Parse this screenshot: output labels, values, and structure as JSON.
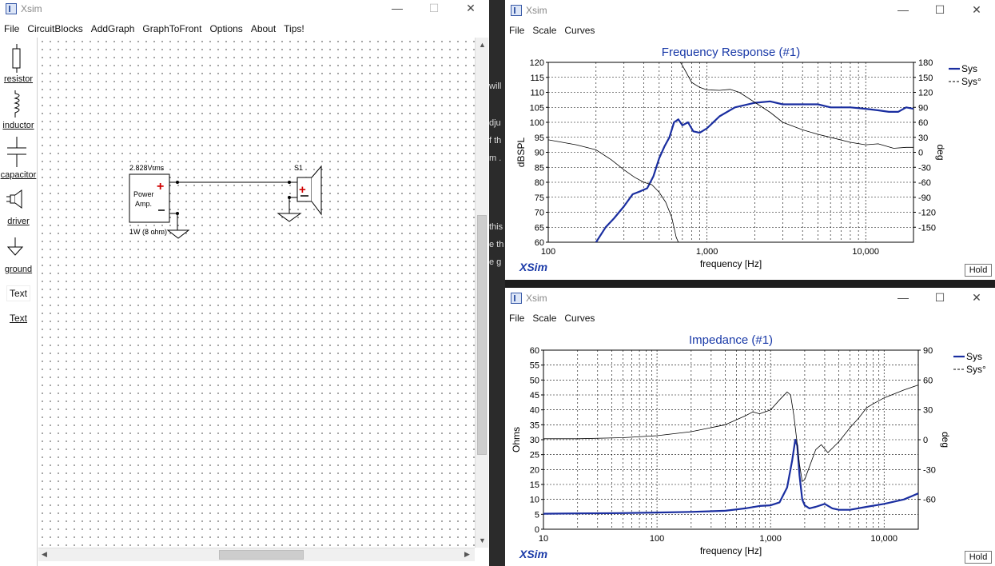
{
  "circuit_window": {
    "title": "Xsim",
    "menu": [
      "File",
      "CircuitBlocks",
      "AddGraph",
      "GraphToFront",
      "Options",
      "About",
      "Tips!"
    ],
    "palette": [
      {
        "label": "resistor",
        "icon": "resistor-icon"
      },
      {
        "label": "inductor",
        "icon": "inductor-icon"
      },
      {
        "label": "capacitor",
        "icon": "capacitor-icon"
      },
      {
        "label": "driver",
        "icon": "driver-icon"
      },
      {
        "label": "ground",
        "icon": "ground-icon"
      },
      {
        "label": "Text",
        "icon": "text-icon",
        "box_text": "Text"
      }
    ],
    "amp": {
      "top_label": "2.828Vrms",
      "body_line1": "Power",
      "body_line2": "Amp.",
      "bottom_label": "1W (8 ohm)"
    },
    "driver_label": "S1"
  },
  "freq_window": {
    "title": "Xsim",
    "menu": [
      "File",
      "Scale",
      "Curves"
    ],
    "hold_label": "Hold",
    "logo": "XSim",
    "chart_data": {
      "type": "line",
      "title": "Frequency Response (#1)",
      "xlabel": "frequency [Hz]",
      "ylabel": "dBSPL",
      "y2label": "deg",
      "xscale": "log",
      "xlim": [
        100,
        20000
      ],
      "ylim": [
        60,
        120
      ],
      "y2lim": [
        -180,
        180
      ],
      "xticks": [
        {
          "v": 100,
          "t": "100"
        },
        {
          "v": 1000,
          "t": "1,000"
        },
        {
          "v": 10000,
          "t": "10,000"
        }
      ],
      "yticks": [
        60,
        65,
        70,
        75,
        80,
        85,
        90,
        95,
        100,
        105,
        110,
        115,
        120
      ],
      "y2ticks": [
        180,
        150,
        120,
        90,
        60,
        30,
        0,
        -30,
        -60,
        -90,
        -120,
        -150
      ],
      "legend": "top-right",
      "grid": true,
      "series": [
        {
          "name": "Sys",
          "axis": "left",
          "style": "solid",
          "x": [
            200,
            230,
            260,
            300,
            340,
            380,
            420,
            460,
            500,
            540,
            580,
            620,
            660,
            700,
            760,
            820,
            900,
            1000,
            1200,
            1500,
            2000,
            2500,
            3000,
            4000,
            5000,
            6000,
            7000,
            8000,
            10000,
            12000,
            14000,
            16000,
            18000,
            20000
          ],
          "y": [
            60,
            65,
            68,
            72,
            76,
            77,
            78,
            82,
            88,
            92,
            95,
            100,
            101,
            99,
            100,
            97,
            96.5,
            98,
            102,
            105,
            106.5,
            107,
            106,
            106,
            106,
            105,
            105,
            105,
            104.5,
            104,
            103.5,
            103.5,
            105,
            104.5
          ]
        },
        {
          "name": "Sys°",
          "axis": "right",
          "style": "dashed",
          "x": [
            100,
            150,
            200,
            250,
            300,
            350,
            400,
            450,
            500,
            550,
            600,
            640,
            660,
            680,
            700,
            740,
            800,
            900,
            1000,
            1200,
            1400,
            1600,
            2000,
            2500,
            3000,
            4000,
            5000,
            6000,
            8000,
            10000,
            12000,
            15000,
            18000,
            20000
          ],
          "y": [
            25,
            15,
            5,
            -15,
            -35,
            -50,
            -60,
            -65,
            -80,
            -100,
            -130,
            -170,
            -180,
            180,
            174,
            160,
            140,
            130,
            125,
            124,
            126,
            120,
            100,
            80,
            60,
            45,
            36,
            30,
            20,
            15,
            17,
            8,
            10,
            10
          ]
        }
      ]
    }
  },
  "imp_window": {
    "title": "Xsim",
    "menu": [
      "File",
      "Scale",
      "Curves"
    ],
    "hold_label": "Hold",
    "logo": "XSim",
    "chart_data": {
      "type": "line",
      "title": "Impedance (#1)",
      "xlabel": "frequency [Hz]",
      "ylabel": "Ohms",
      "y2label": "deg",
      "xscale": "log",
      "xlim": [
        10,
        20000
      ],
      "ylim": [
        0,
        60
      ],
      "y2lim": [
        -90,
        90
      ],
      "xticks": [
        {
          "v": 10,
          "t": "10"
        },
        {
          "v": 100,
          "t": "100"
        },
        {
          "v": 1000,
          "t": "1,000"
        },
        {
          "v": 10000,
          "t": "10,000"
        }
      ],
      "yticks": [
        0,
        5,
        10,
        15,
        20,
        25,
        30,
        35,
        40,
        45,
        50,
        55,
        60
      ],
      "y2ticks": [
        90,
        60,
        30,
        0,
        -30,
        -60
      ],
      "legend": "top-right",
      "grid": true,
      "series": [
        {
          "name": "Sys",
          "axis": "left",
          "style": "solid",
          "x": [
            10,
            20,
            50,
            100,
            200,
            400,
            600,
            800,
            1000,
            1200,
            1400,
            1550,
            1650,
            1720,
            1800,
            1900,
            2000,
            2200,
            2500,
            3000,
            3500,
            4000,
            5000,
            7000,
            10000,
            15000,
            20000
          ],
          "y": [
            5.2,
            5.3,
            5.4,
            5.6,
            5.8,
            6.2,
            7,
            7.8,
            8,
            9,
            14,
            23,
            30,
            28,
            18,
            10,
            8,
            7,
            7.5,
            8.5,
            7,
            6.5,
            6.5,
            7.5,
            8.5,
            10,
            12
          ]
        },
        {
          "name": "Sys°",
          "axis": "right",
          "style": "dashed",
          "x": [
            10,
            20,
            50,
            100,
            200,
            400,
            600,
            700,
            800,
            1000,
            1200,
            1400,
            1500,
            1600,
            1700,
            1800,
            1900,
            2000,
            2500,
            2800,
            3200,
            4000,
            5000,
            6000,
            7000,
            8000,
            10000,
            15000,
            20000
          ],
          "y": [
            1,
            1,
            2,
            4,
            8,
            15,
            24,
            28,
            26,
            30,
            40,
            48,
            45,
            25,
            0,
            -25,
            -42,
            -40,
            -10,
            -5,
            -13,
            -2,
            12,
            22,
            32,
            36,
            42,
            50,
            55
          ]
        }
      ]
    }
  },
  "bg": {
    "lines": [
      "will",
      "dju",
      "f th",
      "m .",
      "this",
      "e th",
      "e g"
    ]
  }
}
